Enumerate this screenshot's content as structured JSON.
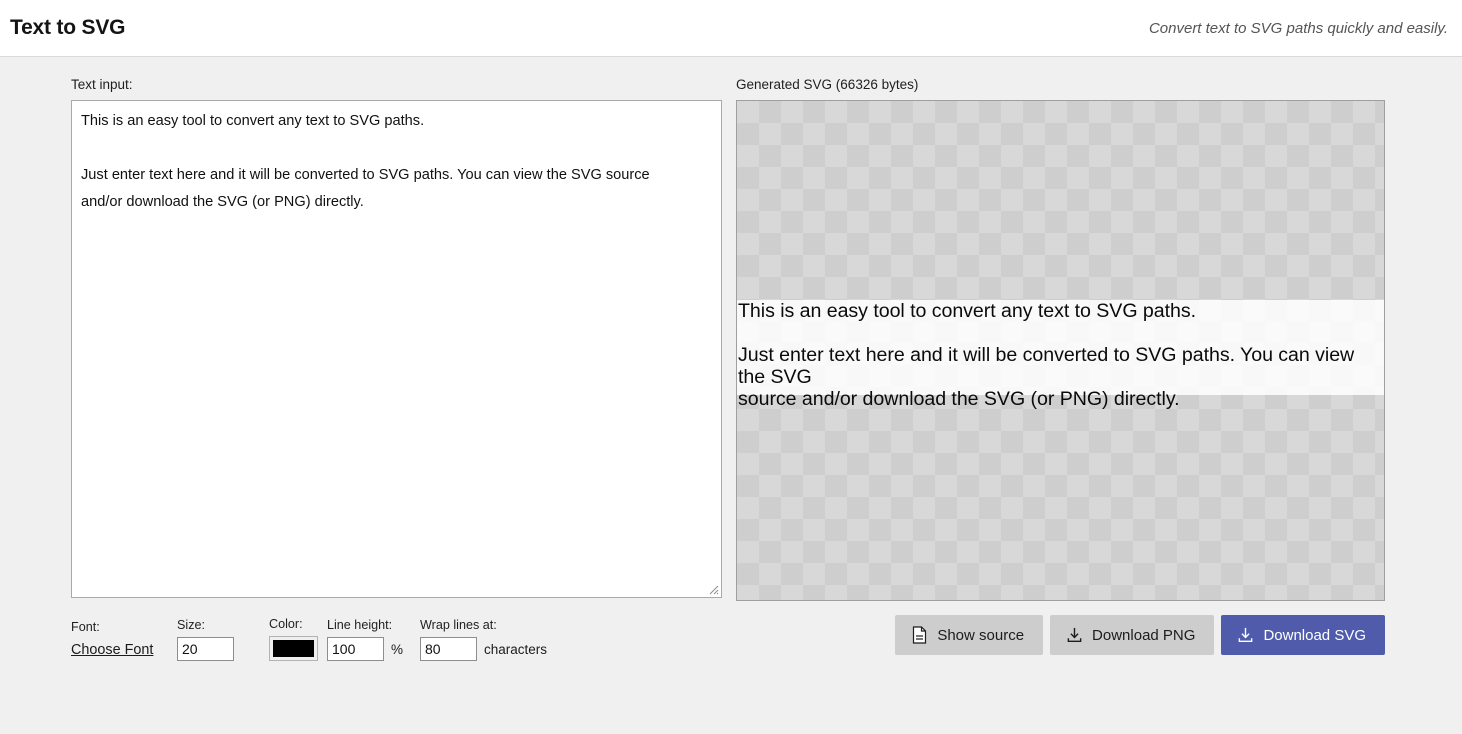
{
  "header": {
    "title": "Text to SVG",
    "tagline": "Convert text to SVG paths quickly and easily."
  },
  "left_panel": {
    "label": "Text input:",
    "textarea": {
      "name": "text-input",
      "value": "This is an easy tool to convert any text to SVG paths.\n\nJust enter text here and it will be converted to SVG paths. You can view the SVG source\nand/or download the SVG (or PNG) directly.",
      "placeholder": ""
    }
  },
  "controls": {
    "font": {
      "label": "Font:",
      "link_text": "Choose Font"
    },
    "size": {
      "label": "Size:",
      "value": "20"
    },
    "color": {
      "label": "Color:",
      "value": "#000000"
    },
    "line_height": {
      "label": "Line height:",
      "value": "100",
      "unit": "%"
    },
    "wrap": {
      "label": "Wrap lines at:",
      "value": "80",
      "unit": "characters"
    }
  },
  "right_panel": {
    "label": "Generated SVG (66326 bytes)",
    "bytes": 66326,
    "preview_text": "This is an easy tool to convert any text to SVG paths.\n\nJust enter text here and it will be converted to SVG paths. You can view the SVG\nsource and/or download the SVG (or PNG) directly.",
    "checker_color_a": "#d8d8d8",
    "checker_color_b": "#cecece"
  },
  "actions": {
    "show_source": {
      "label": "Show source",
      "icon": "document-icon"
    },
    "download_png": {
      "label": "Download PNG",
      "icon": "download-icon"
    },
    "download_svg": {
      "label": "Download SVG",
      "icon": "download-icon",
      "accent": "#505cab"
    }
  }
}
